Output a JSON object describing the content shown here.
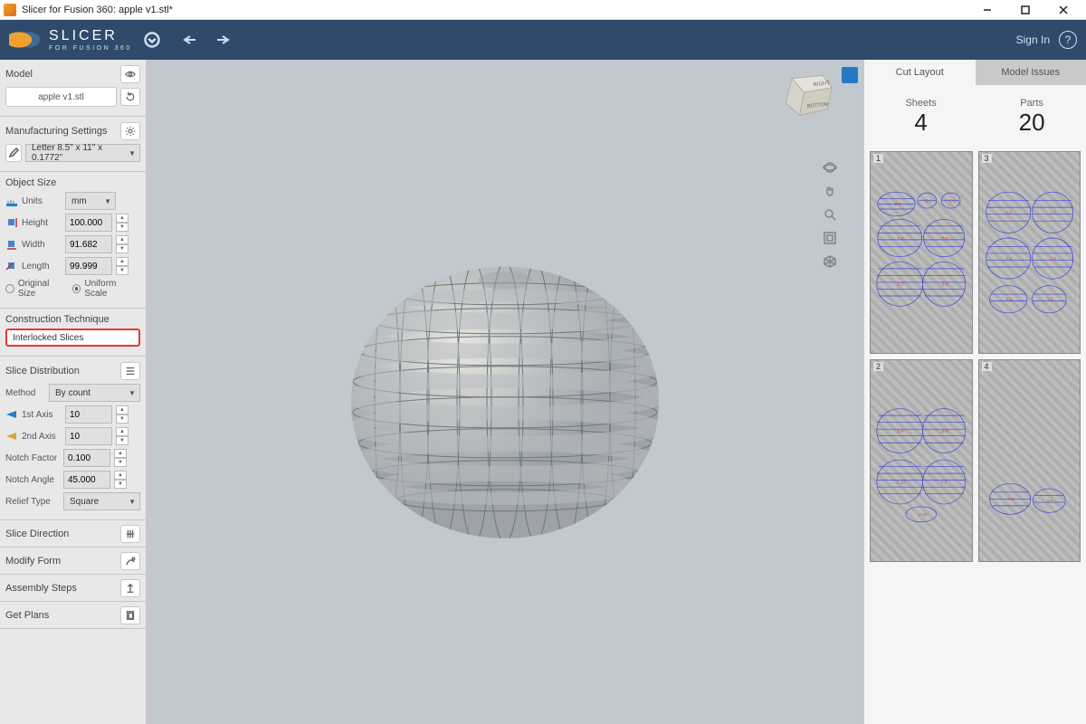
{
  "window": {
    "title": "Slicer for Fusion 360: apple v1.stl*",
    "minimize": "—",
    "maximize": "□",
    "close": "✕"
  },
  "header": {
    "brand_top": "SLICER",
    "brand_sub": "FOR FUSION 360",
    "sign_in": "Sign In",
    "help": "?"
  },
  "sidebar": {
    "model": {
      "title": "Model",
      "filename": "apple v1.stl"
    },
    "manufacturing": {
      "title": "Manufacturing Settings",
      "preset": "Letter 8.5\" x 11\" x 0.1772\""
    },
    "object_size": {
      "title": "Object Size",
      "units_label": "Units",
      "units_value": "mm",
      "height_label": "Height",
      "height_value": "100.000",
      "width_label": "Width",
      "width_value": "91.682",
      "length_label": "Length",
      "length_value": "99.999",
      "original_size": "Original Size",
      "uniform_scale": "Uniform Scale"
    },
    "construction": {
      "title": "Construction Technique",
      "value": "Interlocked Slices"
    },
    "slice_distribution": {
      "title": "Slice Distribution",
      "method_label": "Method",
      "method_value": "By count",
      "axis1_label": "1st Axis",
      "axis1_value": "10",
      "axis2_label": "2nd Axis",
      "axis2_value": "10",
      "notch_factor_label": "Notch Factor",
      "notch_factor_value": "0.100",
      "notch_angle_label": "Notch Angle",
      "notch_angle_value": "45.000",
      "relief_type_label": "Relief Type",
      "relief_type_value": "Square"
    },
    "collapsed": {
      "slice_direction": "Slice Direction",
      "modify_form": "Modify Form",
      "assembly_steps": "Assembly Steps",
      "get_plans": "Get Plans"
    }
  },
  "viewcube": {
    "right": "RIGHT",
    "bottom": "BOTTOM"
  },
  "right": {
    "tabs": {
      "cut_layout": "Cut Layout",
      "model_issues": "Model Issues"
    },
    "stats": {
      "sheets_label": "Sheets",
      "sheets_value": "4",
      "parts_label": "Parts",
      "parts_value": "20"
    },
    "sheets": [
      {
        "num": "1"
      },
      {
        "num": "3"
      },
      {
        "num": "2"
      },
      {
        "num": "4"
      }
    ]
  }
}
